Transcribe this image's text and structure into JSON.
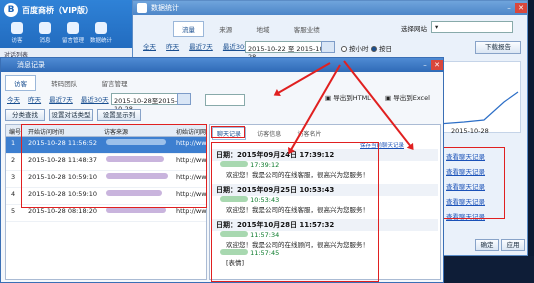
{
  "back_app": {
    "title": "百度商桥（VIP版）",
    "toolbar": [
      "访客",
      "消息",
      "留言管理",
      "数据统计"
    ],
    "sub_label": "对话列表"
  },
  "stats_window": {
    "title": "数据统计",
    "tabs": [
      "流量",
      "来源",
      "地域",
      "客服业绩"
    ],
    "filters": [
      "全天",
      "昨天",
      "最近7天",
      "最近30天"
    ],
    "date_from": "2015-10-22",
    "date_to": "2015-10-28",
    "radios": [
      "按小时",
      "按日"
    ],
    "site_label": "选择网站",
    "download_btn": "下载报告",
    "axis_date": "2015-10-28",
    "links": [
      "查看聊天记录",
      "查看聊天记录",
      "查看聊天记录",
      "查看聊天记录",
      "查看聊天记录"
    ],
    "btn_ok": "确定",
    "btn_apply": "应用"
  },
  "chat_window": {
    "title": "消息记录",
    "tabs": [
      "访客",
      "转码团队",
      "留言管理"
    ],
    "filters": [
      "今天",
      "昨天",
      "最近7天",
      "最近30天"
    ],
    "date_from": "2015-10-28",
    "date_to": "2015-10-28",
    "export_html": "导出到HTML",
    "export_excel": "导出到Excel",
    "buttons": [
      "分类查找",
      "设置对话类型",
      "设置显示列"
    ],
    "columns": [
      "编号",
      "开始访问时间",
      "访客来源",
      "初始访问网址"
    ],
    "rows": [
      {
        "no": "1",
        "time": "2015-10-28 11:56:52",
        "url": "http://ww"
      },
      {
        "no": "2",
        "time": "2015-10-28 11:48:37",
        "url": "http://ww"
      },
      {
        "no": "3",
        "time": "2015-10-28 10:59:10",
        "url": "http://ww"
      },
      {
        "no": "4",
        "time": "2015-10-28 10:59:10",
        "url": "http://ww"
      },
      {
        "no": "5",
        "time": "2015-10-28 08:18:20",
        "url": "http://ww"
      }
    ],
    "pane_tabs": [
      "聊天记录",
      "访客信息",
      "访客名片"
    ],
    "save_link": "保存当前聊天记录",
    "messages": [
      {
        "date": "日期：2015年09月24日 17:39:12",
        "time": "17:39:12",
        "text": "欢迎您！我是公司的在线客服，很高兴为您服务！"
      },
      {
        "date": "日期：2015年09月25日 10:53:43",
        "time": "10:53:43",
        "text": "欢迎您！我是公司的在线客服，很高兴为您服务！"
      },
      {
        "date": "日期：2015年10月28日 11:57:32",
        "time": "11:57:34",
        "text": "欢迎您！我是公司的在线顾问，很高兴为您服务！"
      }
    ],
    "extra_time": "11:57:45",
    "extra_text": "[表情]"
  }
}
